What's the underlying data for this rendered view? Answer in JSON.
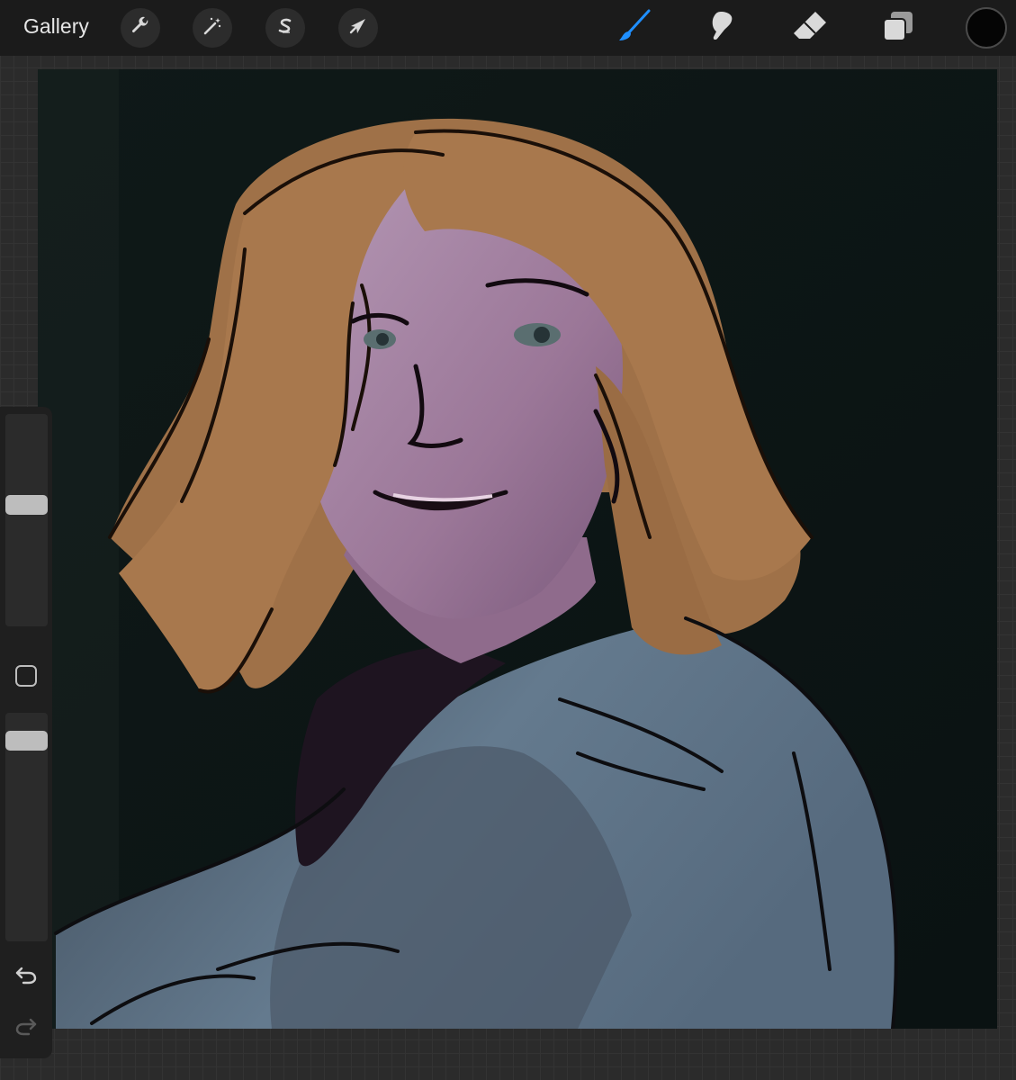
{
  "topbar": {
    "gallery_label": "Gallery",
    "tools_left": [
      {
        "name": "actions",
        "icon": "wrench-icon"
      },
      {
        "name": "adjustments",
        "icon": "magic-wand-icon"
      },
      {
        "name": "selection",
        "icon": "selection-s-icon"
      },
      {
        "name": "transform",
        "icon": "cursor-arrow-icon"
      }
    ],
    "tools_right": [
      {
        "name": "brush",
        "icon": "brush-icon",
        "active": true
      },
      {
        "name": "smudge",
        "icon": "smudge-icon",
        "active": false
      },
      {
        "name": "eraser",
        "icon": "eraser-icon",
        "active": false
      },
      {
        "name": "layers",
        "icon": "layers-icon",
        "active": false
      }
    ],
    "current_color": "#050505"
  },
  "sidebar": {
    "brush_size_icon": "size-slider",
    "opacity_icon": "opacity-slider",
    "modify_icon": "square-modify-icon",
    "undo_icon": "undo-icon",
    "redo_icon": "redo-icon"
  },
  "colors": {
    "accent": "#1f8fff",
    "toolbar_bg": "#1b1b1b",
    "canvas_bg": "#0d1615",
    "hair": "#a8784d",
    "skin": "#9d7a9a",
    "jacket": "#5f7287"
  }
}
